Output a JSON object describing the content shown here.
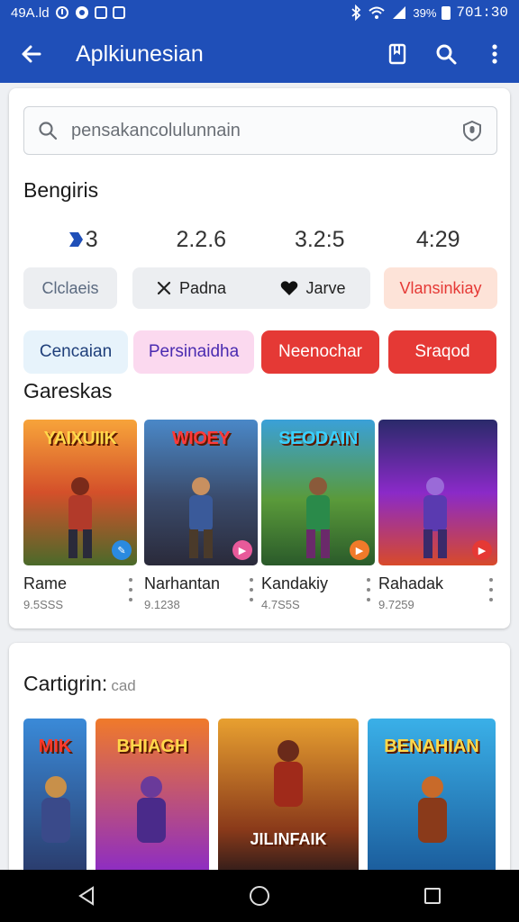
{
  "status_bar": {
    "left_text": "49A.ld",
    "battery_text": "39%",
    "time": "701:30"
  },
  "app_bar": {
    "title": "Aplkiunesian"
  },
  "search": {
    "placeholder": "pensakancolulunnain"
  },
  "section1": {
    "title": "Bengiris"
  },
  "numbers": [
    "3",
    "2.2.6",
    "3.2:5",
    "4:29"
  ],
  "chips": [
    {
      "label": "Clclaeis"
    },
    {
      "label": "Padna"
    },
    {
      "label": "Jarve"
    },
    {
      "label": "Vlansinkiay"
    }
  ],
  "category_tiles": [
    {
      "label": "Cencaian"
    },
    {
      "label": "Persinaidha"
    },
    {
      "label": "Neenochar"
    },
    {
      "label": "Sraqod"
    }
  ],
  "games_section": {
    "title": "Gareskas",
    "items": [
      {
        "cover_title": "YAIXUIIK",
        "name": "Rame",
        "sub": "9.5SSS"
      },
      {
        "cover_title": "WIOEY",
        "name": "Narhantan",
        "sub": "9.1238"
      },
      {
        "cover_title": "SEODAIN",
        "name": "Kandakiy",
        "sub": "4.7S5S"
      },
      {
        "cover_title": "",
        "name": "Rahadak",
        "sub": "9.7259"
      }
    ]
  },
  "section2": {
    "title": "Cartigrin:",
    "subtitle": "cad",
    "tiles": [
      {
        "cover_title": "MIK"
      },
      {
        "cover_title": "BHIAGH"
      },
      {
        "cover_title": "JILINFAIK"
      },
      {
        "cover_title": "BENAHIAN"
      }
    ]
  },
  "colors": {
    "primary": "#1f4fb8",
    "accent_red": "#e53935",
    "chip_bg": "#eceef1",
    "pink_chip": "#fde3d8"
  }
}
